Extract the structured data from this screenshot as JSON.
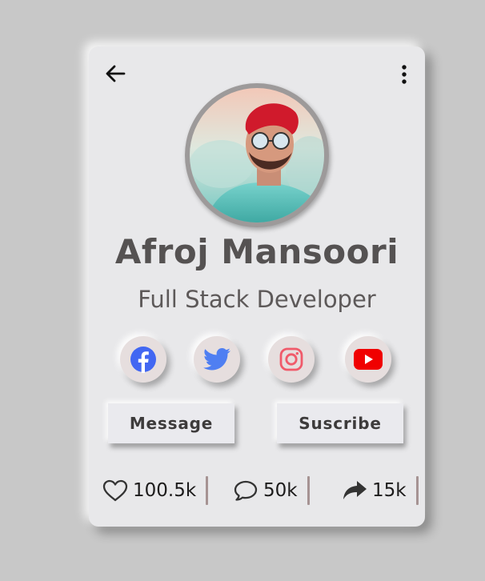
{
  "profile": {
    "name": "Afroj Mansoori",
    "role": "Full Stack Developer"
  },
  "social": [
    {
      "name": "facebook",
      "icon": "facebook-icon",
      "color": "#4267f2"
    },
    {
      "name": "twitter",
      "icon": "twitter-icon",
      "color": "#4f7ff2"
    },
    {
      "name": "instagram",
      "icon": "instagram-icon",
      "color": "#f05a6a"
    },
    {
      "name": "youtube",
      "icon": "youtube-icon",
      "color": "#f00000"
    }
  ],
  "buttons": {
    "message_label": "Message",
    "subscribe_label": "Suscribe"
  },
  "stats": {
    "likes": "100.5k",
    "comments": "50k",
    "shares": "15k"
  },
  "colors": {
    "background": "#c8c8c8",
    "card": "#e8e8ea",
    "name_text": "#555252",
    "divider": "#a69393"
  }
}
